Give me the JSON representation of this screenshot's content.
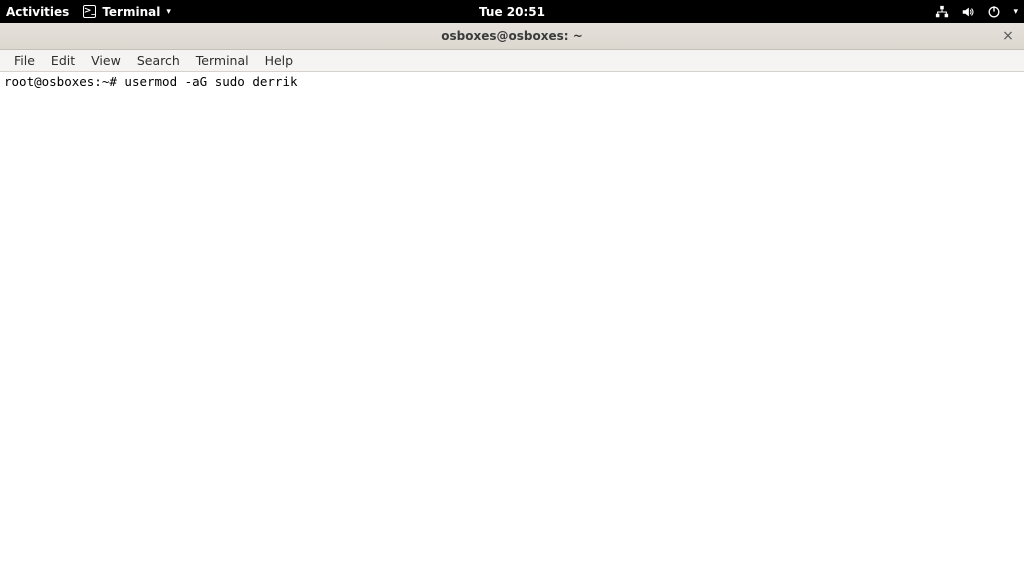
{
  "panel": {
    "activities": "Activities",
    "app_name": "Terminal",
    "clock": "Tue 20:51"
  },
  "window": {
    "title": "osboxes@osboxes: ~"
  },
  "menubar": {
    "items": [
      "File",
      "Edit",
      "View",
      "Search",
      "Terminal",
      "Help"
    ]
  },
  "terminal": {
    "prompt": "root@osboxes:~# ",
    "command": "usermod -aG sudo derrik"
  }
}
